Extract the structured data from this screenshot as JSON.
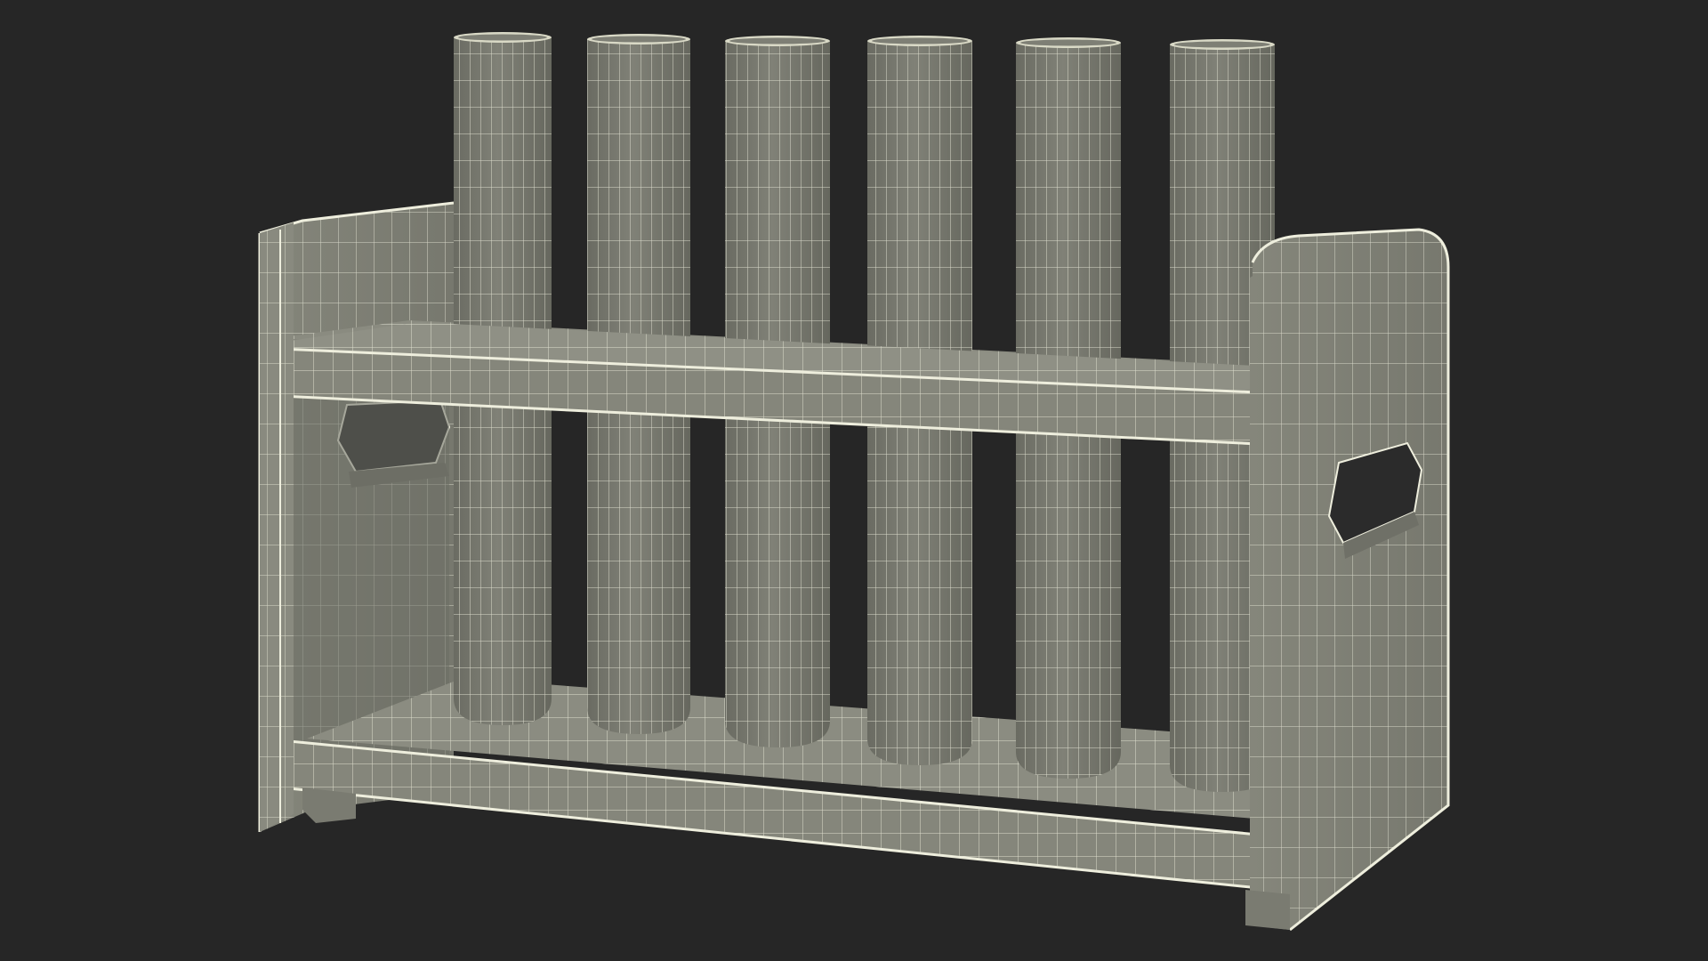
{
  "viewport": {
    "background": "#262626"
  },
  "model": {
    "object": "test-tube-rack-wireframe",
    "tube_count": 6,
    "colors": {
      "surface": "#7e7f75",
      "surface_dark": "#65665d",
      "surface_light": "#909186",
      "wire": "#eeeedd",
      "rim": "#d9d9c6"
    }
  }
}
